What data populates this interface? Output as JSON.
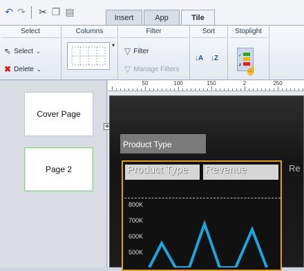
{
  "toolbar": {
    "icons": [
      "undo-icon",
      "redo-icon",
      "cut-icon",
      "copy-icon",
      "paste-icon"
    ]
  },
  "tabs": [
    {
      "label": "Insert"
    },
    {
      "label": "App"
    },
    {
      "label": "Tile",
      "active": true
    }
  ],
  "ribbon": {
    "groups": {
      "select": {
        "title": "Select",
        "select_label": "Select",
        "delete_label": "Delete"
      },
      "columns": {
        "title": "Columns"
      },
      "filter": {
        "title": "Filter",
        "filter_label": "Filter",
        "manage_label": "Manage Filters"
      },
      "sort": {
        "title": "Sort"
      },
      "stoplight": {
        "title": "Stoplight"
      }
    }
  },
  "pages": [
    {
      "label": "Cover Page",
      "selected": false
    },
    {
      "label": "Page 2",
      "selected": true
    }
  ],
  "ruler": {
    "marks": [
      "50",
      "100",
      "150",
      "2",
      "250"
    ]
  },
  "report": {
    "product_type_filter": "Product Type",
    "table_headers": [
      "Product Type",
      "Revenue"
    ],
    "next_tile_label": "Re",
    "y_ticks": [
      "800K",
      "700K",
      "600K",
      "500K"
    ]
  },
  "colors": {
    "accent": "#e5a023",
    "line": "#1aa7e0"
  }
}
